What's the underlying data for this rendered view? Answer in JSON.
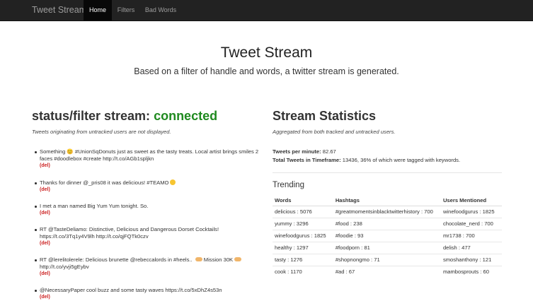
{
  "nav": {
    "brand": "Tweet Stream",
    "items": [
      {
        "label": "Home",
        "active": true
      },
      {
        "label": "Filters"
      },
      {
        "label": "Bad Words"
      }
    ]
  },
  "hero": {
    "title": "Tweet Stream",
    "subtitle": "Based on a filter of handle and words, a twitter stream is generated."
  },
  "stream": {
    "title_prefix": "status/filter stream: ",
    "status": "connected",
    "status_color": "#1f8a1f",
    "note": "Tweets originating from untracked users are not displayed.",
    "del_label": "(del)",
    "tweets": [
      "Something 😊 #UnionSqDonuts just as sweet as the tasty treats. Local artist brings smiles 2 faces #doodlebox #create http://t.co/AGb1spljkn",
      "Thanks for dinner @_pris08 it was delicious! #TEAMO",
      "I met a man named Big Yum Yum tonight. So.",
      "RT @TasteDeliamo: Distinctive, Delicious and Dangerous Dorset Cocktails! https://t.co/3Tq1y4V9lh http://t.co/qjFQTk0czv",
      "RT @lerelitolerele: Delicious brunette @rebeccalords in #heels..",
      "Mission 30K",
      "http://t.co/yvji5gEybv",
      "@NecessaryPaper cool buzz and some tasty waves https://t.co/5xDhZ4s53n"
    ]
  },
  "stats": {
    "title": "Stream Statistics",
    "note": "Aggregated from both tracked and untracked users.",
    "tpm_label": "Tweets per minute:",
    "tpm_value": "82.67",
    "total_label": "Total Tweets in Timeframe:",
    "total_value": "13436, 36% of which were tagged with keywords."
  },
  "trending": {
    "title": "Trending",
    "headers": [
      "Words",
      "Hashtags",
      "Users Mentioned"
    ],
    "rows": [
      [
        "delicious : 5076",
        "#greatmomentsinblacktwitterhistory : 700",
        "winefoodgurus : 1825"
      ],
      [
        "yummy : 3296",
        "#food : 238",
        "chocolate_nerd : 700"
      ],
      [
        "winefoodgurus : 1825",
        "#foodie : 93",
        "mr1738 : 700"
      ],
      [
        "healthy : 1297",
        "#foodporn : 81",
        "delish : 477"
      ],
      [
        "tasty : 1276",
        "#shopnongmo : 71",
        "smoshanthony : 121"
      ],
      [
        "cook : 1170",
        "#ad : 67",
        "mambosprouts : 60"
      ]
    ]
  }
}
